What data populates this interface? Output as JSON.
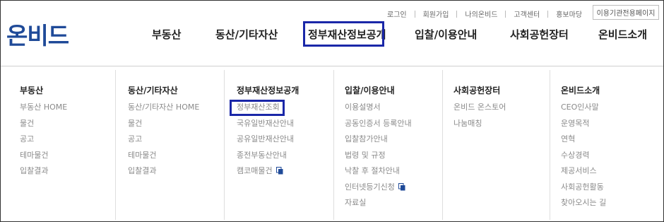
{
  "utility_links": [
    "로그인",
    "회원가입",
    "나의온비드",
    "고객센터",
    "홍보마당"
  ],
  "institution_button": "이용기관전용페이지",
  "logo_text": "온비드",
  "nav": [
    "부동산",
    "동산/기타자산",
    "정부재산정보공개",
    "입찰/이용안내",
    "사회공헌장터",
    "온비드소개"
  ],
  "active_nav": "정부재산정보공개",
  "columns": [
    {
      "title": "부동산",
      "items": [
        "부동산 HOME",
        "물건",
        "공고",
        "테마물건",
        "입찰결과"
      ]
    },
    {
      "title": "동산/기타자산",
      "items": [
        "동산/기타자산 HOME",
        "물건",
        "공고",
        "테마물건",
        "입찰결과"
      ]
    },
    {
      "title": "정부재산정보공개",
      "items": [
        "정부재산조회",
        "국유일반재산안내",
        "공유일반재산안내",
        "종전부동산안내",
        "캠코매물건"
      ]
    },
    {
      "title": "입찰/이용안내",
      "items": [
        "이용설명서",
        "공동인증서 등록안내",
        "입찰참가안내",
        "법령 및 규정",
        "낙찰 후 절차안내",
        "인터넷등기신청",
        "자료실"
      ]
    },
    {
      "title": "사회공헌장터",
      "items": [
        "온비드 온스토어",
        "나눔매칭"
      ]
    },
    {
      "title": "온비드소개",
      "items": [
        "CEO인사말",
        "운영목적",
        "연혁",
        "수상경력",
        "제공서비스",
        "사회공헌활동",
        "찾아오시는 길"
      ]
    }
  ],
  "highlighted_item": "정부재산조회",
  "colors": {
    "logo": "#1f4a98",
    "highlight_box": "#1a27a8",
    "menu_text": "#8a8a8a"
  }
}
